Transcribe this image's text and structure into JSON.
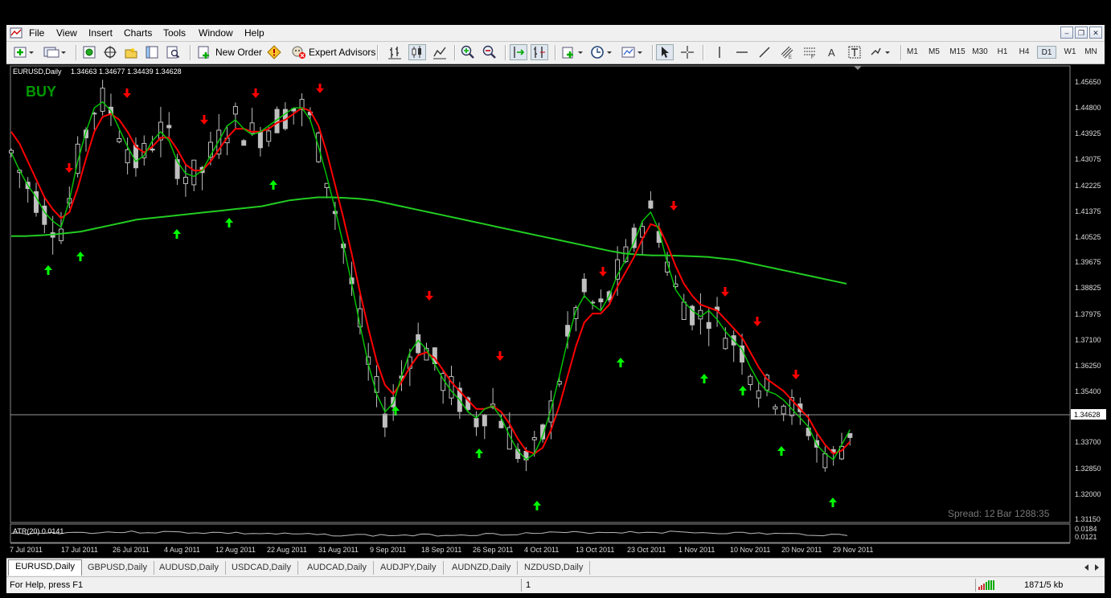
{
  "menu": [
    "File",
    "View",
    "Insert",
    "Charts",
    "Tools",
    "Window",
    "Help"
  ],
  "toolbar": {
    "new_order_label": "New Order",
    "expert_advisors_label": "Expert Advisors",
    "timeframes": [
      "M1",
      "M5",
      "M15",
      "M30",
      "H1",
      "H4",
      "D1",
      "W1",
      "MN"
    ],
    "active_timeframe": "D1"
  },
  "chart": {
    "title": "EURUSD,Daily",
    "ohlc": "1.34663 1.34677 1.34439 1.34628",
    "signal_label": "BUY",
    "current_price": "1.34628",
    "price_ticks": [
      "1.45650",
      "1.44800",
      "1.43925",
      "1.43075",
      "1.42225",
      "1.41375",
      "1.40525",
      "1.39675",
      "1.38825",
      "1.37975",
      "1.37100",
      "1.36250",
      "1.35400",
      "1.33700",
      "1.32850",
      "1.32000",
      "1.31150"
    ],
    "date_ticks": [
      "7 Jul 2011",
      "17 Jul 2011",
      "26 Jul 2011",
      "4 Aug 2011",
      "12 Aug 2011",
      "22 Aug 2011",
      "31 Aug 2011",
      "9 Sep 2011",
      "18 Sep 2011",
      "26 Sep 2011",
      "4 Oct 2011",
      "13 Oct 2011",
      "23 Oct 2011",
      "1 Nov 2011",
      "10 Nov 2011",
      "20 Nov 2011",
      "29 Nov 2011"
    ],
    "spread_label": "Spread: 12",
    "bar_timer": "Bar  1288:35",
    "atr_label": "ATR(20) 0.0141",
    "atr_ticks": [
      "0.0184",
      "0.0121"
    ],
    "colors": {
      "background": "#000000",
      "fast_ma": "#00cc00",
      "slow_ma": "#ff0000",
      "long_ma": "#22cc22",
      "up_arrow": "#00ff00",
      "down_arrow": "#ff0000",
      "candle": "#bfbfbf",
      "buy_text": "#009900"
    }
  },
  "chart_data": {
    "type": "line",
    "series": [
      {
        "values": [
          1.431,
          1.425,
          1.42,
          1.416,
          1.411,
          1.408,
          1.406,
          1.415,
          1.428,
          1.438,
          1.446,
          1.448,
          1.445,
          1.439,
          1.433,
          1.428,
          1.43,
          1.435,
          1.438,
          1.435,
          1.428,
          1.424,
          1.423,
          1.425,
          1.43,
          1.435,
          1.44,
          1.442,
          1.439,
          1.437,
          1.438,
          1.44,
          1.442,
          1.444,
          1.446,
          1.446,
          1.442,
          1.433,
          1.423,
          1.412,
          1.4,
          1.387,
          1.373,
          1.36,
          1.35,
          1.344,
          1.347,
          1.356,
          1.364,
          1.368,
          1.365,
          1.36,
          1.355,
          1.351,
          1.348,
          1.344,
          1.342,
          1.345,
          1.346,
          1.342,
          1.336,
          1.331,
          1.328,
          1.33,
          1.336,
          1.345,
          1.356,
          1.368,
          1.378,
          1.383,
          1.38,
          1.378,
          1.383,
          1.39,
          1.395,
          1.401,
          1.408,
          1.411,
          1.405,
          1.394,
          1.385,
          1.381,
          1.378,
          1.376,
          1.378,
          1.375,
          1.371,
          1.368,
          1.365,
          1.359,
          1.354,
          1.351,
          1.35,
          1.348,
          1.345,
          1.342,
          1.339,
          1.333,
          1.33,
          1.328,
          1.333,
          1.338
        ]
      },
      {
        "values": [
          1.438,
          1.434,
          1.428,
          1.422,
          1.416,
          1.412,
          1.409,
          1.411,
          1.419,
          1.429,
          1.438,
          1.443,
          1.444,
          1.442,
          1.438,
          1.433,
          1.431,
          1.433,
          1.436,
          1.436,
          1.432,
          1.427,
          1.425,
          1.425,
          1.428,
          1.432,
          1.436,
          1.439,
          1.439,
          1.438,
          1.438,
          1.439,
          1.441,
          1.442,
          1.444,
          1.446,
          1.445,
          1.44,
          1.431,
          1.42,
          1.409,
          1.397,
          1.384,
          1.372,
          1.361,
          1.353,
          1.35,
          1.354,
          1.359,
          1.363,
          1.364,
          1.362,
          1.358,
          1.354,
          1.351,
          1.348,
          1.345,
          1.345,
          1.346,
          1.344,
          1.34,
          1.335,
          1.331,
          1.33,
          1.332,
          1.338,
          1.346,
          1.356,
          1.366,
          1.374,
          1.377,
          1.377,
          1.38,
          1.386,
          1.391,
          1.396,
          1.402,
          1.407,
          1.406,
          1.4,
          1.393,
          1.387,
          1.383,
          1.38,
          1.379,
          1.378,
          1.375,
          1.372,
          1.369,
          1.364,
          1.359,
          1.355,
          1.353,
          1.351,
          1.348,
          1.345,
          1.342,
          1.337,
          1.333,
          1.33,
          1.331,
          1.334
        ]
      },
      {
        "values": [
          1.403,
          1.403,
          1.4032,
          1.4035,
          1.404,
          1.4045,
          1.4055,
          1.4065,
          1.4075,
          1.4085,
          1.409,
          1.4095,
          1.41,
          1.4105,
          1.411,
          1.4115,
          1.412,
          1.4125,
          1.413,
          1.414,
          1.415,
          1.4155,
          1.416,
          1.416,
          1.4158,
          1.4155,
          1.415,
          1.414,
          1.413,
          1.412,
          1.411,
          1.41,
          1.409,
          1.408,
          1.407,
          1.406,
          1.405,
          1.404,
          1.403,
          1.402,
          1.401,
          1.4,
          1.399,
          1.398,
          1.3972,
          1.3968,
          1.3965,
          1.3965,
          1.3964,
          1.3962,
          1.396,
          1.3955,
          1.395,
          1.394,
          1.393,
          1.392,
          1.391,
          1.39,
          1.389,
          1.388,
          1.387
        ]
      }
    ],
    "ylim": [
      1.308,
      1.459
    ]
  },
  "tabs": [
    "EURUSD,Daily",
    "GBPUSD,Daily",
    "AUDUSD,Daily",
    "USDCAD,Daily",
    "AUDCAD,Daily",
    "AUDJPY,Daily",
    "AUDNZD,Daily",
    "NZDUSD,Daily"
  ],
  "status": {
    "help": "For Help, press F1",
    "page": "1",
    "traffic": "1871/5 kb"
  }
}
